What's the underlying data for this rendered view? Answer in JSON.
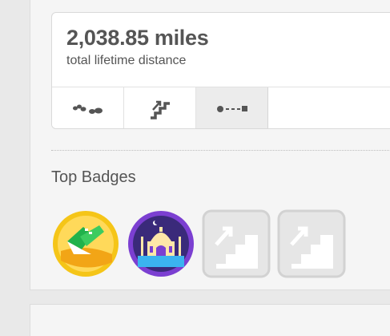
{
  "stats": {
    "distance_value": "2,038.85 miles",
    "distance_caption": "total lifetime distance"
  },
  "tabs": [
    {
      "icon": "footsteps-icon",
      "active": false
    },
    {
      "icon": "stairs-icon",
      "active": false
    },
    {
      "icon": "distance-path-icon",
      "active": true
    }
  ],
  "badges_section": {
    "title": "Top Badges",
    "badges": [
      {
        "icon": "shoe-badge-icon",
        "color": "#f5c518"
      },
      {
        "icon": "taj-mahal-badge-icon",
        "color": "#7b3fd1"
      },
      {
        "icon": "stairs-badge-icon",
        "state": "locked"
      },
      {
        "icon": "stairs-badge-icon",
        "state": "locked"
      }
    ]
  }
}
